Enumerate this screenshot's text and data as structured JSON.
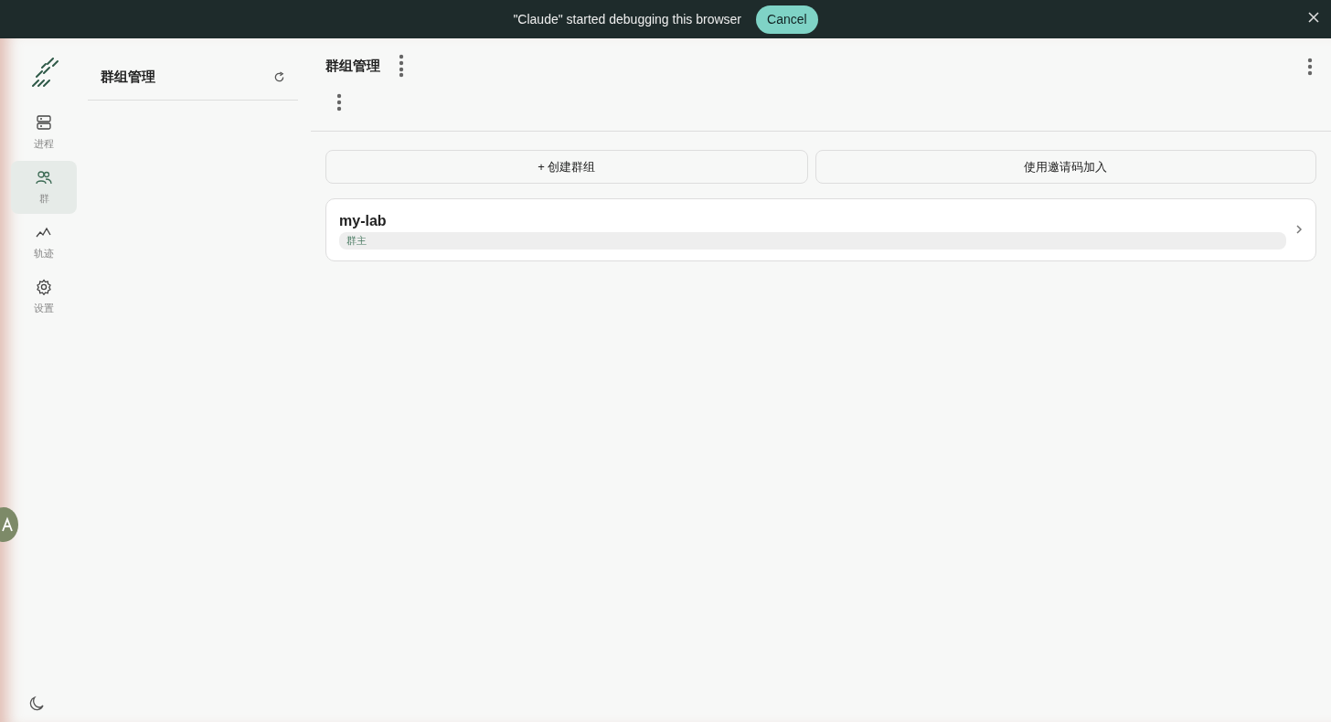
{
  "banner": {
    "message": "\"Claude\" started debugging this browser",
    "cancel": "Cancel"
  },
  "nav": [
    {
      "label": "进程",
      "selected": false
    },
    {
      "label": "群",
      "selected": true
    },
    {
      "label": "轨迹",
      "selected": false
    },
    {
      "label": "设置",
      "selected": false
    }
  ],
  "side_panel": {
    "title": "群组管理"
  },
  "main": {
    "title": "群组管理",
    "create_button": "+ 创建群组",
    "join_button": "使用邀请码加入",
    "groups": [
      {
        "name": "my-lab",
        "role": "群主"
      }
    ]
  }
}
